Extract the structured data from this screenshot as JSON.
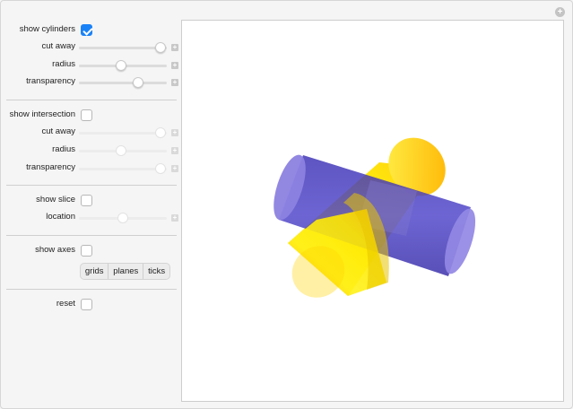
{
  "cylinders": {
    "show_label": "show cylinders",
    "show_checked": true,
    "cut_away": {
      "label": "cut away",
      "value": 0.93
    },
    "radius": {
      "label": "radius",
      "value": 0.48
    },
    "transparency": {
      "label": "transparency",
      "value": 0.67
    }
  },
  "intersection": {
    "show_label": "show intersection",
    "show_checked": false,
    "cut_away": {
      "label": "cut away",
      "value": 0.93
    },
    "radius": {
      "label": "radius",
      "value": 0.48
    },
    "transparency": {
      "label": "transparency",
      "value": 0.93
    }
  },
  "slice": {
    "show_label": "show slice",
    "show_checked": false,
    "location": {
      "label": "location",
      "value": 0.5
    }
  },
  "axes": {
    "show_label": "show axes",
    "show_checked": false,
    "options": [
      "grids",
      "planes",
      "ticks"
    ]
  },
  "reset": {
    "label": "reset",
    "checked": false
  },
  "plus_glyph": "+",
  "colors": {
    "accent": "#1a82f7",
    "blue_cylinder": "#4b3ec7",
    "yellow_cylinder": "#ffea1a"
  }
}
